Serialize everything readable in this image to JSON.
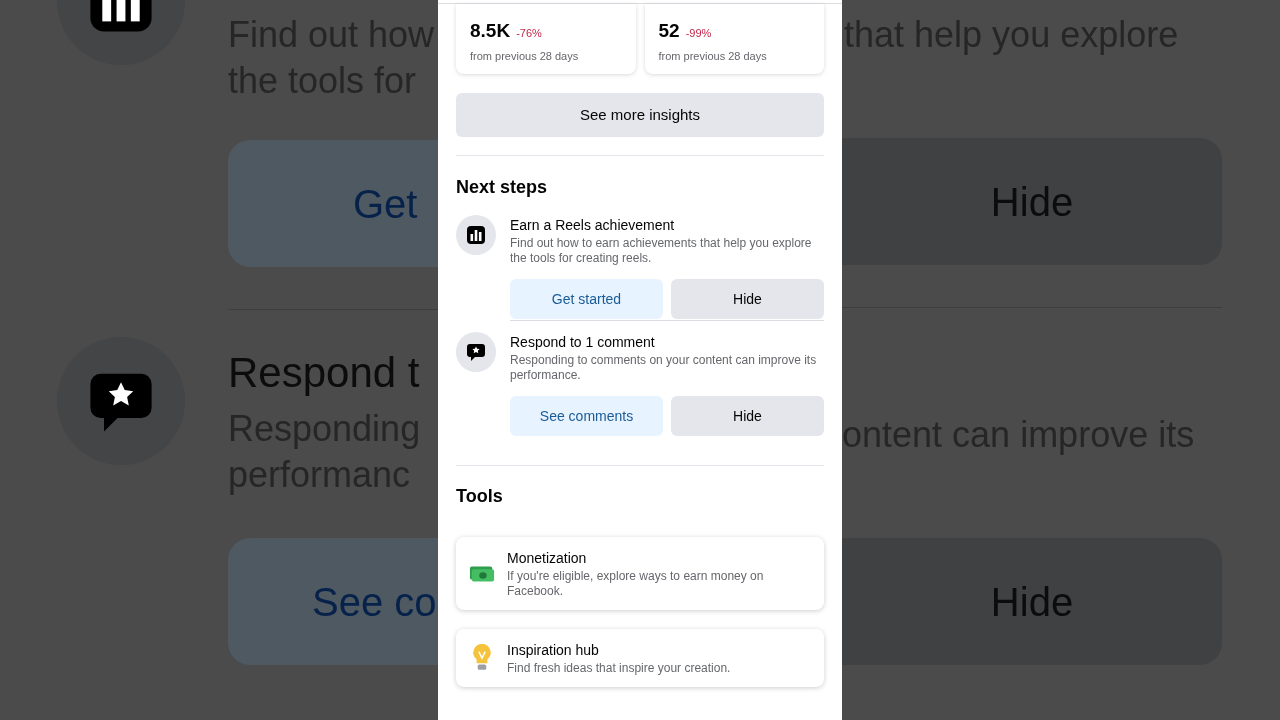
{
  "backdrop": {
    "left": {
      "description_lines": [
        "Find out how",
        "the tools for"
      ],
      "action": "Get",
      "title": "Respond t",
      "description_lines_2": [
        "Responding",
        "performanc"
      ],
      "action_2": "See co"
    },
    "right": {
      "description_lines": [
        "that help you explore"
      ],
      "action": "Hide",
      "description_lines_2": [
        "ontent can improve its"
      ],
      "action_2": "Hide"
    }
  },
  "stats": [
    {
      "value": "8.5K",
      "change": "-76%",
      "caption": "from previous 28 days"
    },
    {
      "value": "52",
      "change": "-99%",
      "caption": "from previous 28 days"
    }
  ],
  "see_more": "See more insights",
  "next_steps": {
    "title": "Next steps",
    "items": [
      {
        "title": "Earn a Reels achievement",
        "description": "Find out how to earn achievements that help you explore the tools for creating reels.",
        "primary": "Get started",
        "secondary": "Hide"
      },
      {
        "title": "Respond to 1 comment",
        "description": "Responding to comments on your content can improve its performance.",
        "primary": "See comments",
        "secondary": "Hide"
      }
    ]
  },
  "tools": {
    "title": "Tools",
    "items": [
      {
        "title": "Monetization",
        "description": "If you're eligible, explore ways to earn money on Facebook."
      },
      {
        "title": "Inspiration hub",
        "description": "Find fresh ideas that inspire your creation."
      }
    ]
  }
}
